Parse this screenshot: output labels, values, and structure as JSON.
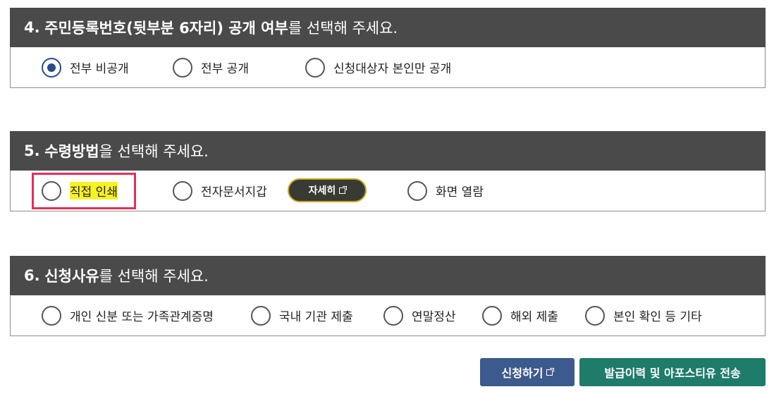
{
  "section4": {
    "number": "4.",
    "title_bold": "주민등록번호(뒷부분 6자리) 공개 여부",
    "title_rest": "를 선택해 주세요.",
    "options": [
      {
        "label": "전부 비공개",
        "checked": true
      },
      {
        "label": "전부 공개",
        "checked": false
      },
      {
        "label": "신청대상자 본인만 공개",
        "checked": false
      }
    ]
  },
  "section5": {
    "number": "5.",
    "title_bold": "수령방법",
    "title_rest": "을 선택해 주세요.",
    "options": [
      {
        "label": "직접 인쇄",
        "checked": false,
        "highlighted": true
      },
      {
        "label": "전자문서지갑",
        "checked": false
      },
      {
        "label": "화면 열람",
        "checked": false
      }
    ],
    "detail_button": "자세히"
  },
  "section6": {
    "number": "6.",
    "title_bold": "신청사유",
    "title_rest": "를 선택해 주세요.",
    "options": [
      {
        "label": "개인 신분 또는 가족관계증명",
        "checked": false
      },
      {
        "label": "국내 기관 제출",
        "checked": false
      },
      {
        "label": "연말정산",
        "checked": false
      },
      {
        "label": "해외 제출",
        "checked": false
      },
      {
        "label": "본인 확인 등 기타",
        "checked": false
      }
    ]
  },
  "buttons": {
    "apply": "신청하기",
    "history": "발급이력 및 아포스티유 전송"
  },
  "colors": {
    "header_bg": "#4a4a4a",
    "radio_checked": "#2b4a8e",
    "highlight_yellow": "#f7f227",
    "highlight_border": "#e0305a",
    "apply_button": "#3d5a8e",
    "history_button": "#1f7b6a"
  },
  "icons": [
    "external-link-icon"
  ]
}
